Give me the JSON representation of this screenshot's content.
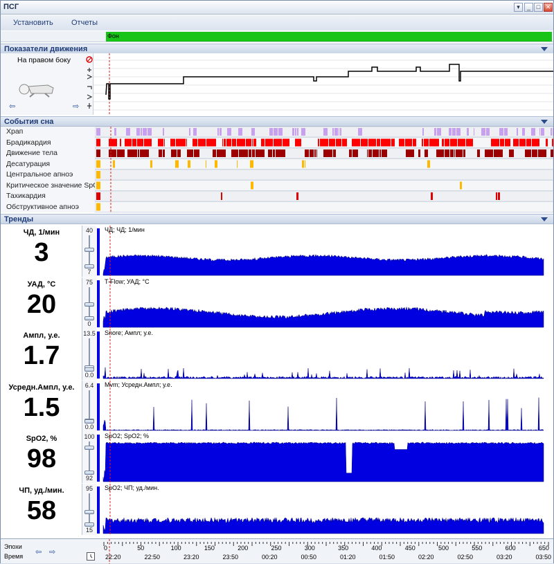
{
  "window": {
    "title": "ПСГ"
  },
  "menu": {
    "items": [
      "Установить",
      "Отчеты"
    ]
  },
  "top_strip": {
    "label": "Фон",
    "color": "#18c418"
  },
  "sections": {
    "movement": "Показатели движения",
    "events": "События сна",
    "trends": "Тренды"
  },
  "movement": {
    "position_label": "На правом боку",
    "icons": [
      "alarm-icon",
      "prev-arrow-icon",
      "next-arrow-icon",
      "body-position-icon"
    ]
  },
  "events": {
    "rows": [
      {
        "label": "Храп",
        "color": "#c8a0f0"
      },
      {
        "label": "Брадикардия",
        "color": "#ff0000"
      },
      {
        "label": "Движение тела",
        "color": "#9c0000"
      },
      {
        "label": "Десатурация",
        "color": "#ffb800"
      },
      {
        "label": "Центральное апноэ",
        "color": "#ffb800"
      },
      {
        "label": "Критическое значение SpO2",
        "color": "#ffb800"
      },
      {
        "label": "Тахикардия",
        "color": "#e00000"
      },
      {
        "label": "Обструктивное апноэ",
        "color": "#ffb800"
      }
    ]
  },
  "trends": [
    {
      "title": "ЧД, 1/мин",
      "value": "3",
      "max": "40",
      "min": "7",
      "caption": "ЧД; ЧД; 1/мин",
      "level": 0.55
    },
    {
      "title": "УАД, °C",
      "value": "20",
      "max": "75",
      "min": "0",
      "caption": "T-Flow; УАД; °C",
      "level": 0.45
    },
    {
      "title": "Ампл, у.е.",
      "value": "1.7",
      "max": "13.5",
      "min": "0.0",
      "caption": "Snore; Ампл; у.е.",
      "level": 0.08
    },
    {
      "title": "Усредн.Ампл, у.е.",
      "value": "1.5",
      "max": "6.4",
      "min": "0.0",
      "caption": "Mvm; Усредн.Ампл; у.е.",
      "level": 0.04
    },
    {
      "title": "SpO2, %",
      "value": "98",
      "max": "100",
      "min": "92",
      "caption": "SpO2; SpO2; %",
      "level": 0.8
    },
    {
      "title": "ЧП, уд./мин.",
      "value": "58",
      "max": "95",
      "min": "15",
      "caption": "SpO2; ЧП; уд./мин.",
      "level": 0.4
    }
  ],
  "chart_color": "#0000e0",
  "timeline": {
    "epochs_label": "Эпохи",
    "time_label": "Время",
    "epochs": [
      "0",
      "50",
      "100",
      "150",
      "200",
      "250",
      "300",
      "350",
      "400",
      "450",
      "500",
      "550",
      "600",
      "650"
    ],
    "times": [
      "22:20",
      "22:50",
      "23:20",
      "23:50",
      "00:20",
      "00:50",
      "01:20",
      "01:50",
      "02:20",
      "02:50",
      "03:20",
      "03:50"
    ]
  }
}
